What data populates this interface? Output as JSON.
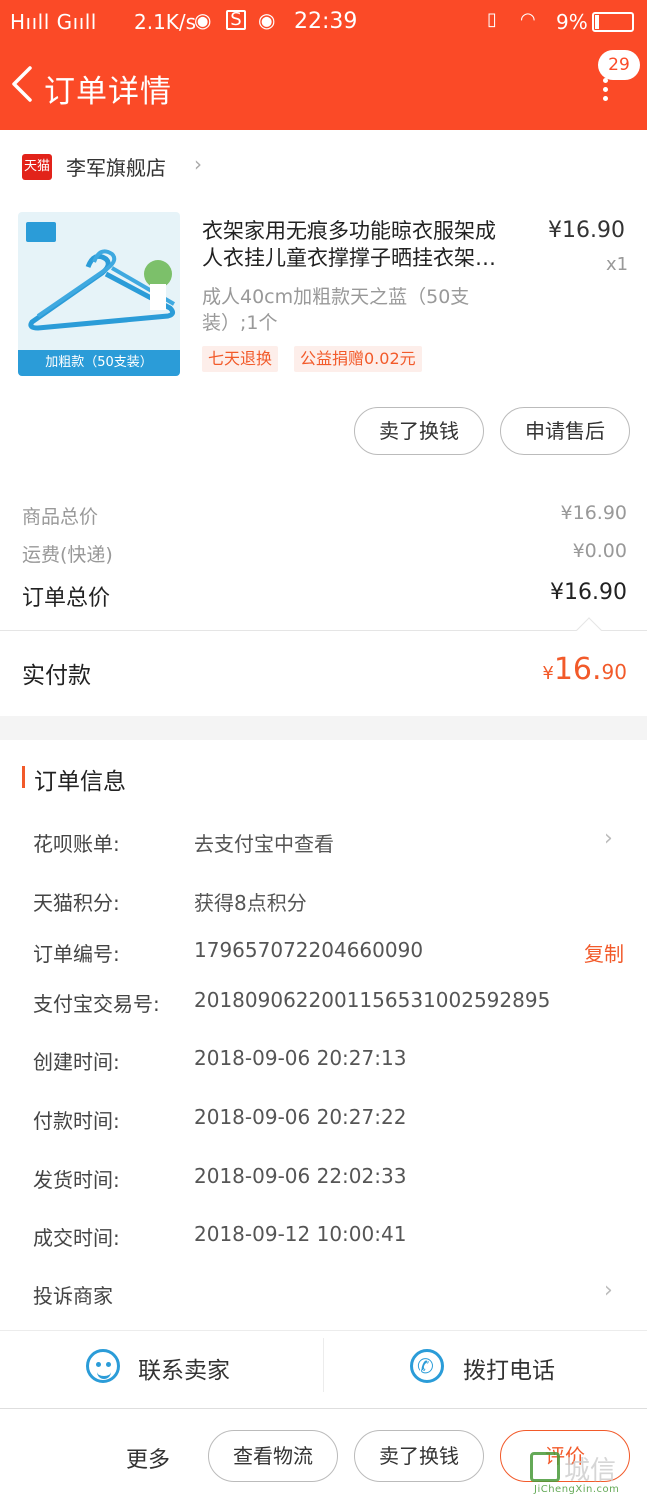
{
  "status_bar": {
    "signal": "H",
    "signal2": "G",
    "net_speed": "2.1K/s",
    "time": "22:39",
    "battery_pct": "9%"
  },
  "header": {
    "title": "订单详情",
    "badge_count": "29"
  },
  "store": {
    "logo_text": "天猫",
    "name": "李军旗舰店"
  },
  "product": {
    "title_line1": "衣架家用无痕多功能晾衣服架成",
    "title_line2": "人衣挂儿童衣撑撑子晒挂衣架…",
    "price": "¥16.90",
    "qty": "x1",
    "spec": "成人40cm加粗款天之蓝（50支装）;1个",
    "image_caption": "加粗款（50支装）",
    "tags": [
      "七天退换",
      "公益捐赠0.02元"
    ]
  },
  "product_actions": {
    "sell": "卖了换钱",
    "aftersale": "申请售后"
  },
  "summary": {
    "goods_label": "商品总价",
    "goods_value": "¥16.90",
    "shipping_label": "运费(快递)",
    "shipping_value": "¥0.00",
    "total_label": "订单总价",
    "total_value": "¥16.90",
    "paid_label": "实付款",
    "paid_currency": "¥",
    "paid_int": "16.",
    "paid_dec": "90"
  },
  "order_info": {
    "title": "订单信息",
    "rows": [
      {
        "label": "花呗账单:",
        "value": "去支付宝中查看"
      },
      {
        "label": "天猫积分:",
        "value": "获得8点积分"
      },
      {
        "label": "订单编号:",
        "value": "179657072204660090"
      },
      {
        "label": "支付宝交易号:",
        "value": "2018090622001156531002592895"
      },
      {
        "label": "创建时间:",
        "value": "2018-09-06 20:27:13"
      },
      {
        "label": "付款时间:",
        "value": "2018-09-06 20:27:22"
      },
      {
        "label": "发货时间:",
        "value": "2018-09-06 22:02:33"
      },
      {
        "label": "成交时间:",
        "value": "2018-09-12 10:00:41"
      }
    ],
    "copy_label": "复制",
    "complain_label": "投诉商家"
  },
  "contact": {
    "chat_label": "联系卖家",
    "phone_label": "拨打电话"
  },
  "bottom_bar": {
    "more": "更多",
    "logistics": "查看物流",
    "sell": "卖了换钱",
    "review": "评价"
  },
  "watermark": {
    "text": "城信",
    "url": "JiChengXin.com"
  },
  "colors": {
    "brand": "#fb4a27",
    "accent": "#f25a2a",
    "link_blue": "#2b9cd8"
  }
}
